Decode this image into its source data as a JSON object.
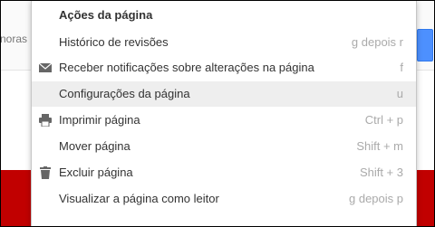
{
  "background": {
    "left_text": "noras"
  },
  "menu": {
    "title": "Ações da página",
    "items": [
      {
        "label": "Histórico de revisões",
        "shortcut": "g depois r",
        "icon": ""
      },
      {
        "label": "Receber notificações sobre alterações na página",
        "shortcut": "f",
        "icon": "envelope-icon"
      },
      {
        "label": "Configurações da página",
        "shortcut": "u",
        "icon": ""
      },
      {
        "label": "Imprimir página",
        "shortcut": "Ctrl + p",
        "icon": "printer-icon"
      },
      {
        "label": "Mover página",
        "shortcut": "Shift + m",
        "icon": ""
      },
      {
        "label": "Excluir página",
        "shortcut": "Shift + 3",
        "icon": "trash-icon"
      },
      {
        "label": "Visualizar a página como leitor",
        "shortcut": "g depois p",
        "icon": ""
      }
    ]
  },
  "colors": {
    "highlight": "#eeeeee",
    "shortcut": "#aaaaaa",
    "red_band": "#c10000",
    "accent": "#4d90fe"
  }
}
